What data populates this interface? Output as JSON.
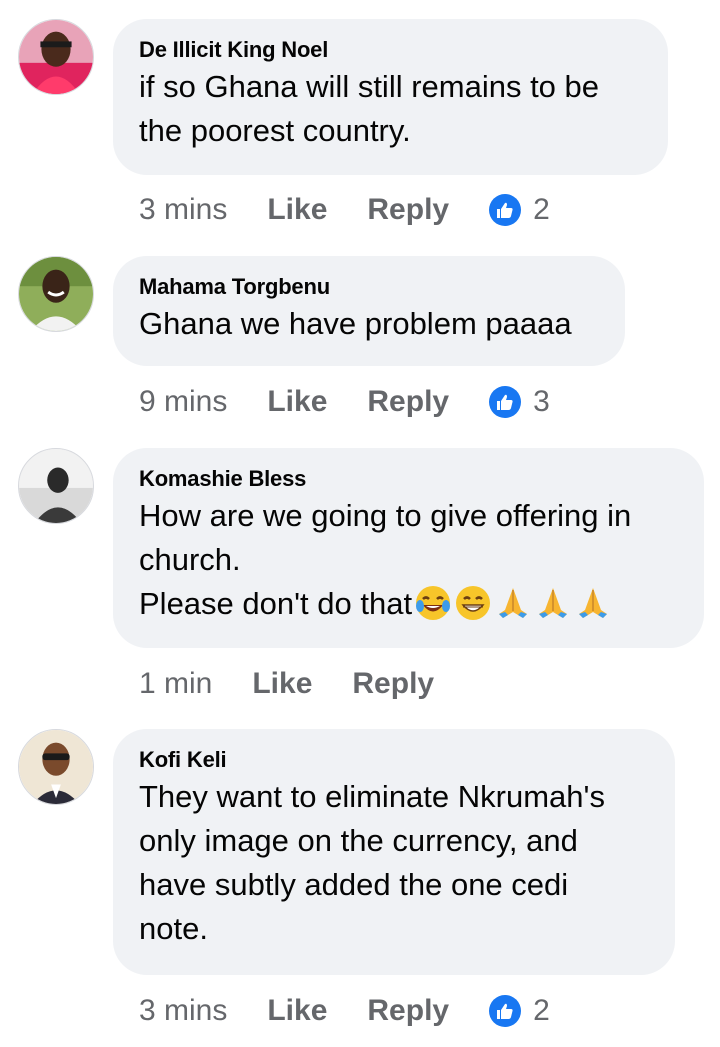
{
  "comments": [
    {
      "author": "De Illicit King Noel",
      "text": "if so Ghana will still remains to be\nthe poorest country.",
      "time": "3 mins",
      "like_label": "Like",
      "reply_label": "Reply",
      "reactions_count": "2"
    },
    {
      "author": "Mahama Torgbenu",
      "text": "Ghana we have problem paaaa",
      "time": "9 mins",
      "like_label": "Like",
      "reply_label": "Reply",
      "reactions_count": "3"
    },
    {
      "author": "Komashie Bless",
      "text": "How are we going to give offering in\nchurch.\nPlease don't do that",
      "emojis": [
        "face-with-tears-of-joy",
        "grinning-face",
        "folded-hands",
        "folded-hands",
        "folded-hands"
      ],
      "time": "1 min",
      "like_label": "Like",
      "reply_label": "Reply"
    },
    {
      "author": "Kofi Keli",
      "text": "They want to eliminate Nkrumah's\nonly image on the currency, and\nhave subtly added the one cedi\nnote.",
      "time": "3 mins",
      "like_label": "Like",
      "reply_label": "Reply",
      "reactions_count": "2"
    }
  ],
  "colors": {
    "bubble": "#f0f2f5",
    "meta_text": "#65676b",
    "like_reaction": "#1877f2"
  }
}
